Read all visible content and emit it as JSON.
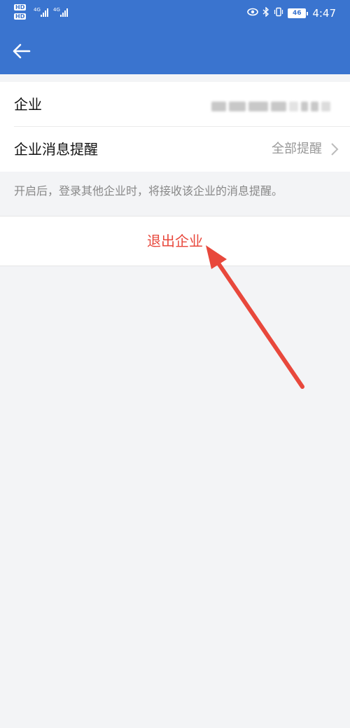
{
  "status_bar": {
    "left_badges": [
      "HD",
      "HD"
    ],
    "left_network": [
      "4G",
      "4G"
    ],
    "battery": "46",
    "time": "4:47",
    "icons": [
      "eye-icon",
      "bluetooth-icon",
      "vibrate-icon"
    ]
  },
  "nav": {
    "back_icon": "back-arrow-icon"
  },
  "settings": {
    "enterprise_label": "企业",
    "notify_label": "企业消息提醒",
    "notify_value": "全部提醒",
    "hint": "开启后，登录其他企业时，将接收该企业的消息提醒。",
    "exit_label": "退出企业"
  },
  "colors": {
    "header": "#3a74cf",
    "exit_text": "#e8483c",
    "annotation_arrow": "#e8483c",
    "background": "#f3f4f6"
  }
}
